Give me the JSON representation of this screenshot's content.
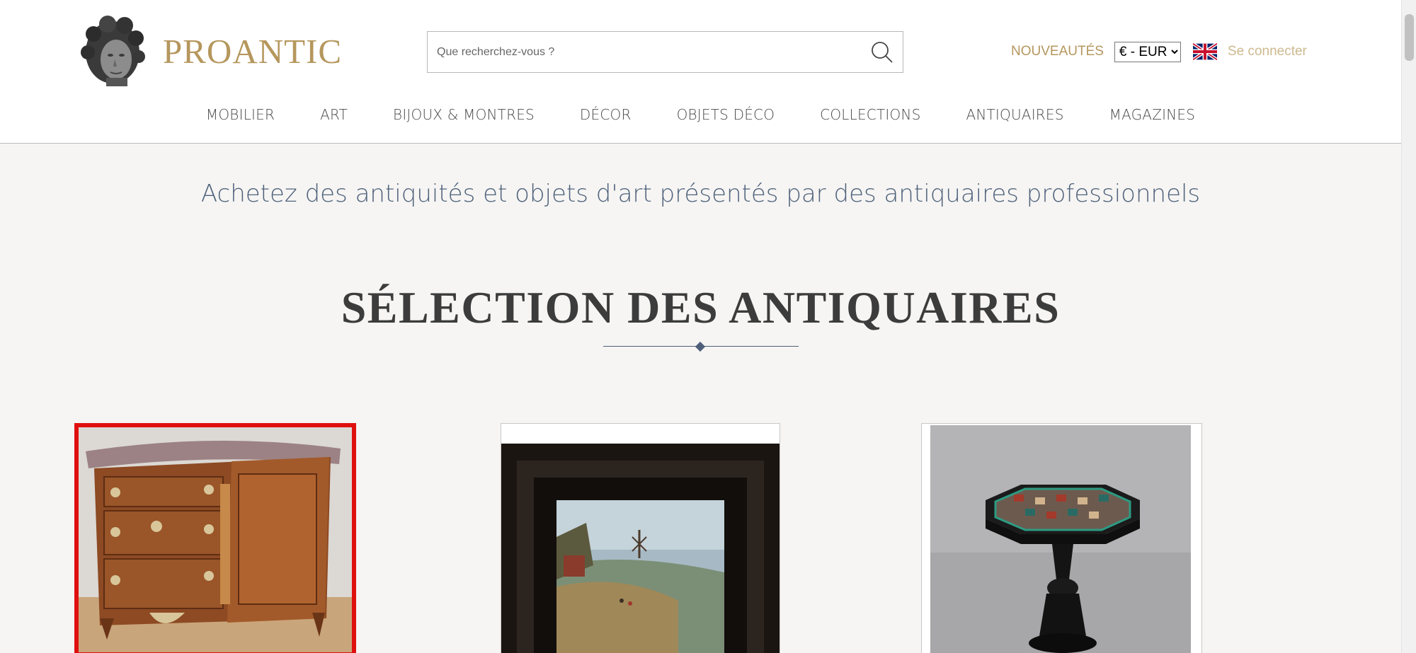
{
  "brand": {
    "name": "PROANTIC",
    "color": "#b5975d"
  },
  "search": {
    "placeholder": "Que recherchez-vous ?"
  },
  "header_links": {
    "new": "NOUVEAUTÉS",
    "currency_selected": "€ - EUR",
    "language_flag": "uk-flag-icon",
    "login": "Se connecter"
  },
  "nav": {
    "items": [
      "MOBILIER",
      "ART",
      "BIJOUX & MONTRES",
      "DÉCOR",
      "OBJETS DÉCO",
      "COLLECTIONS",
      "ANTIQUAIRES",
      "MAGAZINES"
    ]
  },
  "tagline": "Achetez des antiquités et objets d'art présentés par des antiquaires professionnels",
  "section": {
    "title": "SÉLECTION DES ANTIQUAIRES"
  },
  "products": [
    {
      "name": "commode-image",
      "selected": true
    },
    {
      "name": "landscape-painting-image",
      "selected": false
    },
    {
      "name": "pietra-dura-table-image",
      "selected": false
    }
  ],
  "colors": {
    "accent": "#b5975d",
    "tagline": "#4f627c",
    "selection_border": "#e00f0f",
    "background": "#f6f5f3"
  }
}
